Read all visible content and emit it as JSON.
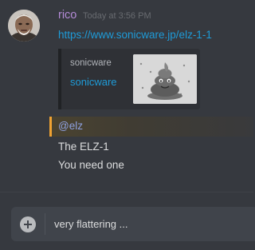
{
  "message": {
    "username": "rico",
    "timestamp": "Today at 3:56 PM",
    "link": "https://www.sonicware.jp/elz-1-1",
    "embed": {
      "provider": "sonicware",
      "title": "sonicware",
      "thumbnail_icon": "poop-emoji-icon"
    }
  },
  "reply": {
    "mention": "@elz",
    "lines": [
      "The ELZ-1",
      "You need one"
    ]
  },
  "composer": {
    "value": "very flattering ..."
  },
  "colors": {
    "background": "#36393f",
    "username": "#b38ad6",
    "link": "#1e9bd8",
    "mention": "#8ea1e1",
    "mention_highlight": "#f0a232",
    "text": "#dcddde",
    "composer_bg": "#40444b"
  }
}
